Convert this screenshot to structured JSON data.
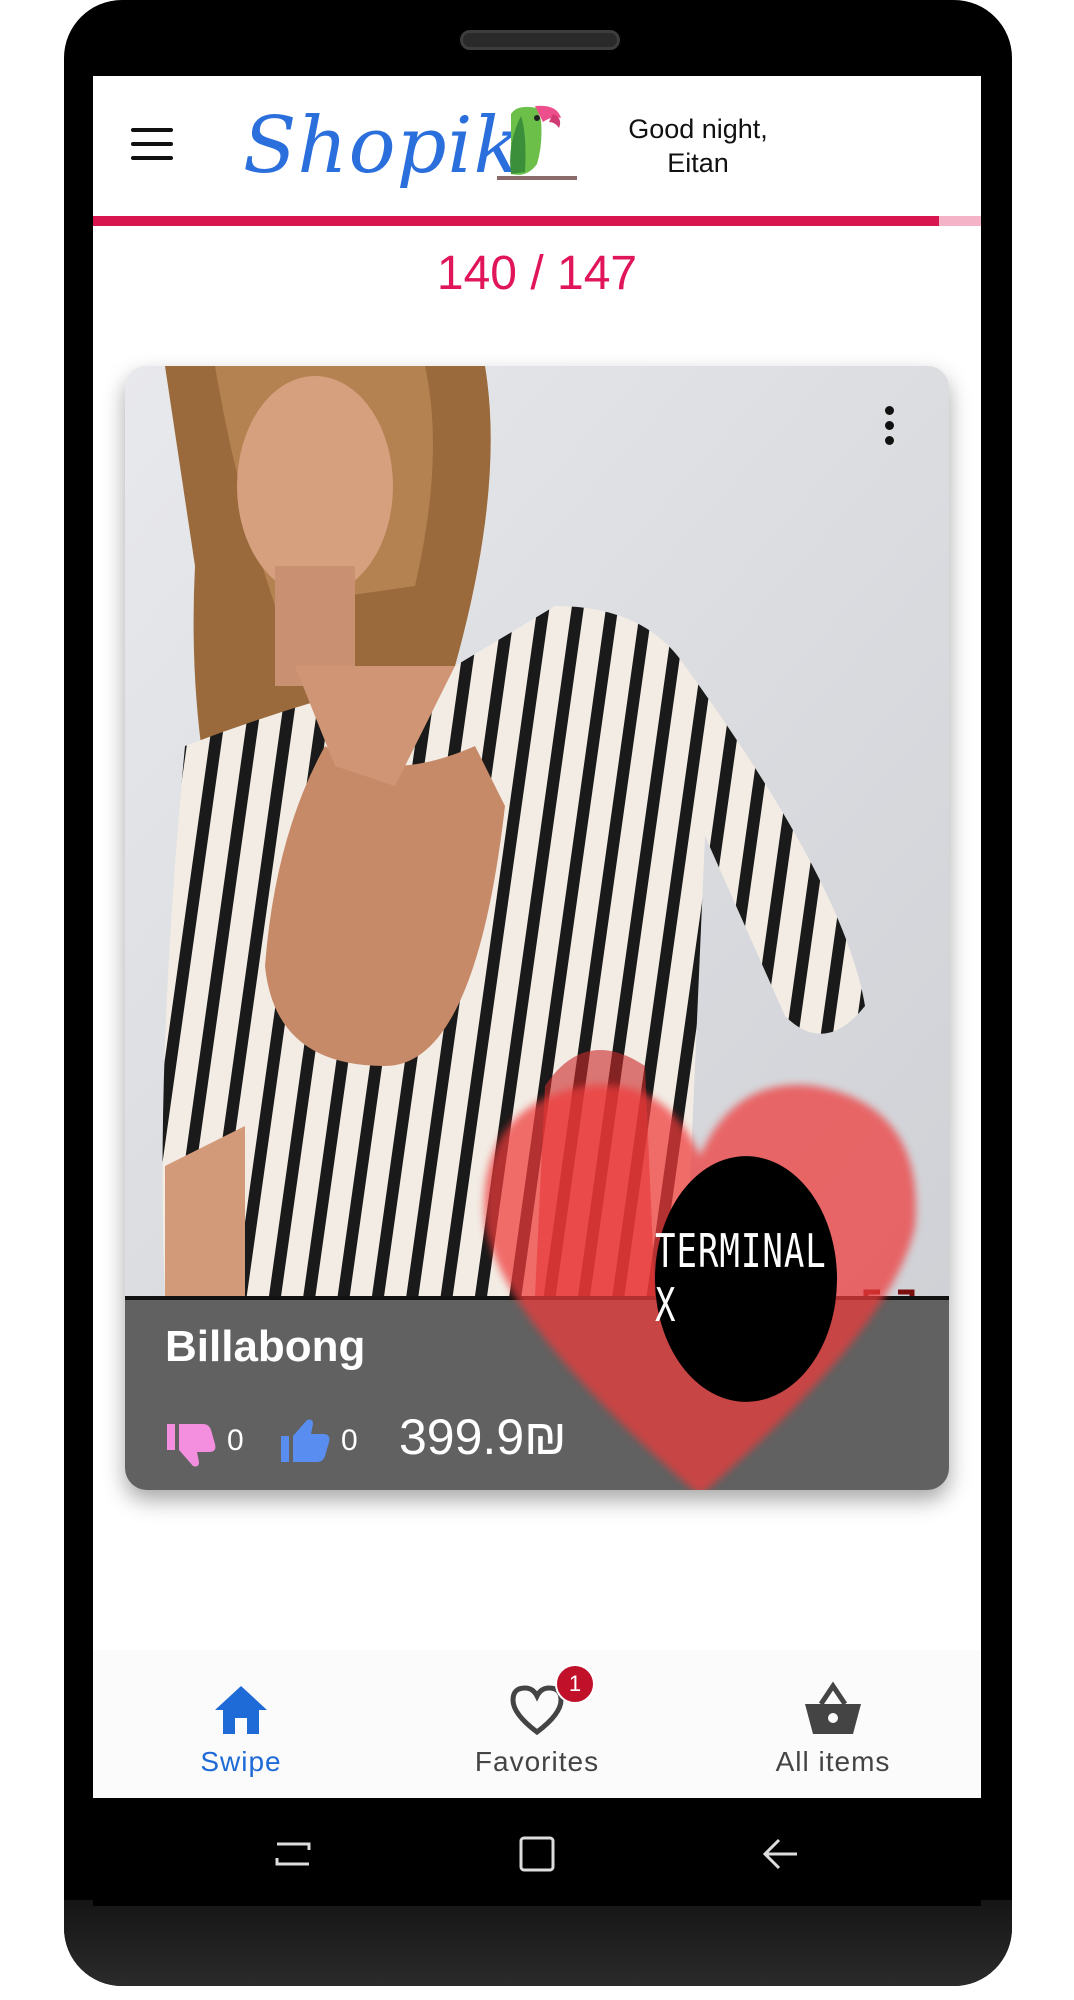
{
  "app": {
    "logo_text": "Shopik",
    "greeting": "Good night,\nEitan",
    "progress": {
      "current": 140,
      "total": 147,
      "label": "140 / 147"
    }
  },
  "card": {
    "brand": "Billabong",
    "dislikes": "0",
    "likes": "0",
    "price": "399.9₪",
    "store": "TERMINAL X",
    "photo_description_icon": "product-photo",
    "favorite_overlay_icon": "heart-icon"
  },
  "bottom_nav": {
    "items": [
      {
        "label": "Swipe",
        "icon": "home-icon",
        "active": true
      },
      {
        "label": "Favorites",
        "icon": "heart-outline-icon",
        "badge": "1"
      },
      {
        "label": "All items",
        "icon": "basket-icon"
      }
    ]
  },
  "colors": {
    "accent_pink": "#e0155a",
    "logo_blue": "#2a6fdc",
    "nav_active": "#1e6ad6",
    "nav_inactive": "#444444"
  }
}
